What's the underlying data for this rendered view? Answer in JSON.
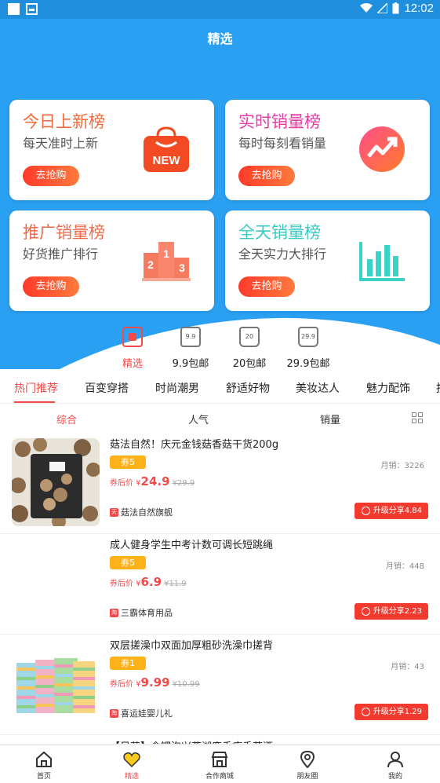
{
  "status_bar": {
    "time": "12:02"
  },
  "header": {
    "title": "精选"
  },
  "rank_cards": [
    {
      "title": "今日上新榜",
      "subtitle": "每天准时上新",
      "button": "去抢购",
      "icon": "new-shopping-bag-icon",
      "badge_text": "NEW",
      "title_color": "#f06a3a"
    },
    {
      "title": "实时销量榜",
      "subtitle": "每时每刻看销量",
      "button": "去抢购",
      "icon": "trend-up-icon",
      "title_color": "#e43ea7"
    },
    {
      "title": "推广销量榜",
      "subtitle": "好货推广排行",
      "button": "去抢购",
      "icon": "podium-icon",
      "podium_labels": [
        "2",
        "1",
        "3"
      ],
      "title_color": "#f06a4a"
    },
    {
      "title": "全天销量榜",
      "subtitle": "全天实力大排行",
      "button": "去抢购",
      "icon": "bar-chart-icon",
      "title_color": "#3bc9c4"
    }
  ],
  "categories": [
    {
      "label": "精选",
      "icon": "featured-icon",
      "active": true
    },
    {
      "label": "9.9包邮",
      "icon": "tag-99-icon",
      "icon_text": "9.9"
    },
    {
      "label": "20包邮",
      "icon": "bag-20-icon",
      "icon_text": "20"
    },
    {
      "label": "29.9包邮",
      "icon": "bag-299-icon",
      "icon_text": "29.9"
    }
  ],
  "tabs": [
    "热门推荐",
    "百变穿搭",
    "时尚潮男",
    "舒适好物",
    "美妆达人",
    "魅力配饰",
    "技"
  ],
  "sort": {
    "options": [
      "综合",
      "人气",
      "销量"
    ],
    "active": "综合"
  },
  "products": [
    {
      "title": "菇法自然！庆元金钱菇香菇干货200g",
      "coupon": "券5",
      "sales": "月销：3226",
      "price_label": "券后价 ¥",
      "price": "24.9",
      "original": "¥29.9",
      "shop": "菇法自然旗舰",
      "shop_icon_text": "天猫",
      "share": "升级分享4.84"
    },
    {
      "title": "成人健身学生中考计数可调长短跳绳",
      "coupon": "券5",
      "sales": "月销：448",
      "price_label": "券后价 ¥",
      "price": "6.9",
      "original": "¥11.9",
      "shop": "三霸体育用品",
      "shop_icon_text": "淘",
      "share": "升级分享2.23"
    },
    {
      "title": "双层搓澡巾双面加厚粗砂洗澡巾搓背",
      "coupon": "券1",
      "sales": "月销：43",
      "price_label": "券后价 ¥",
      "price": "9.99",
      "original": "¥10.99",
      "shop": "喜运娃婴儿礼",
      "shop_icon_text": "淘",
      "share": "升级分享1.29"
    },
    {
      "title": "【日草】食锶泡兴燕湖鹿香瘤香菇酒",
      "coupon": "",
      "sales": "",
      "price_label": "",
      "price": "",
      "original": "",
      "shop": "",
      "shop_icon_text": "",
      "share": ""
    }
  ],
  "bottom_nav": [
    {
      "label": "首页",
      "icon": "home-icon"
    },
    {
      "label": "精选",
      "icon": "heart-icon",
      "active": true
    },
    {
      "label": "合作商城",
      "icon": "store-icon"
    },
    {
      "label": "朋友圈",
      "icon": "location-pin-icon"
    },
    {
      "label": "我的",
      "icon": "user-icon"
    }
  ]
}
